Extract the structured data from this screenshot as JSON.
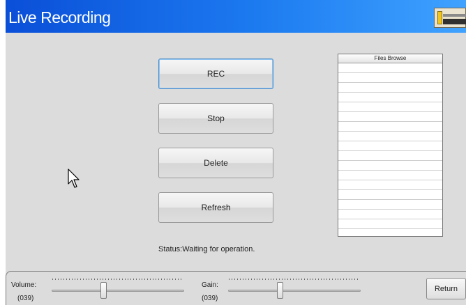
{
  "window": {
    "title": "Live Recording"
  },
  "buttons": {
    "rec": "REC",
    "stop": "Stop",
    "delete": "Delete",
    "refresh": "Refresh",
    "return": "Return"
  },
  "status": {
    "text": "Status:Waiting for operation."
  },
  "files_browse": {
    "header": "Files Browse",
    "rows": []
  },
  "controls": {
    "volume": {
      "label": "Volume:",
      "value_text": "(039)",
      "value": 39
    },
    "gain": {
      "label": "Gain:",
      "value_text": "(039)",
      "value": 39
    }
  },
  "colors": {
    "title_bar_start": "#0a4fd8",
    "title_bar_end": "#3fa2ff",
    "window_bg": "#dcdcdc",
    "selected_button_border": "#4f8ec9"
  },
  "icons": {
    "window_icon": "app-window-icon",
    "cursor": "mouse-cursor-icon"
  }
}
